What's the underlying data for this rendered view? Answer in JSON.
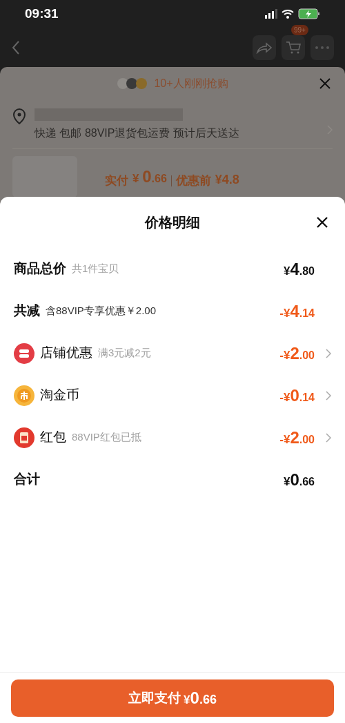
{
  "status_bar": {
    "time": "09:31"
  },
  "nav": {
    "cart_badge": "99+"
  },
  "product_sheet": {
    "buyers_text": "10+人刚刚抢购",
    "delivery": "快递 包邮 88VIP退货包运费 预计后天送达",
    "paid_label": "实付",
    "paid_price": {
      "prefix": "¥ ",
      "major": "0",
      "minor": ".66"
    },
    "original_label": "优惠前",
    "original_price": "¥4.8"
  },
  "modal": {
    "title": "价格明细",
    "rows": [
      {
        "kind": "plain",
        "label": "商品总价",
        "note": "共1件宝贝",
        "price": {
          "prefix": "¥",
          "major": "4",
          "minor": ".80"
        },
        "discount": false,
        "chevron": false
      },
      {
        "kind": "plain",
        "label": "共减",
        "note": "含88VIP专享优惠￥2.00",
        "price": {
          "prefix": "-¥",
          "major": "4",
          "minor": ".14"
        },
        "discount": true,
        "chevron": false
      },
      {
        "kind": "store",
        "label": "店铺优惠",
        "note": "满3元减2元",
        "price": {
          "prefix": "-¥",
          "major": "2",
          "minor": ".00"
        },
        "discount": true,
        "chevron": true
      },
      {
        "kind": "coin",
        "label": "淘金币",
        "price": {
          "prefix": "-¥",
          "major": "0",
          "minor": ".14"
        },
        "discount": true,
        "chevron": true
      },
      {
        "kind": "packet",
        "label": "红包",
        "note": "88VIP红包已抵",
        "price": {
          "prefix": "-¥",
          "major": "2",
          "minor": ".00"
        },
        "discount": true,
        "chevron": true
      },
      {
        "kind": "plain",
        "label": "合计",
        "price": {
          "prefix": "¥",
          "major": "0",
          "minor": ".66"
        },
        "discount": false,
        "chevron": false
      }
    ],
    "pay_button": {
      "label": "立即支付",
      "price": {
        "prefix": "¥",
        "major": "0",
        "minor": ".66"
      }
    }
  }
}
